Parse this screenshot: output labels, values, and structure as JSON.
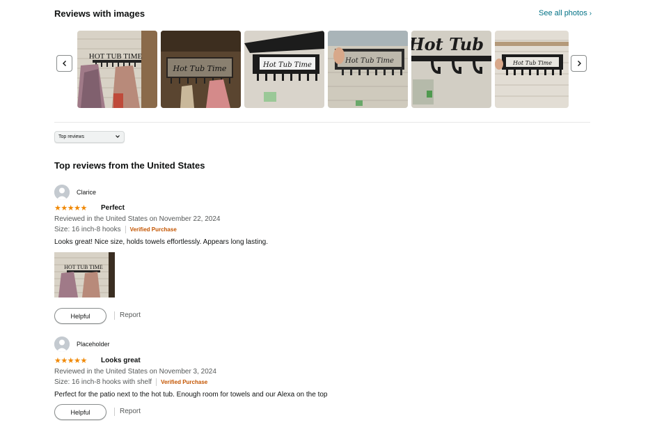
{
  "images_section": {
    "title": "Reviews with images",
    "see_all": "See all photos",
    "see_all_chevron": "›",
    "prev_icon": "chevron-left-icon",
    "next_icon": "chevron-right-icon",
    "thumbnails": [
      {
        "sign_text": "HOT TUB TIME"
      },
      {
        "sign_text": "Hot Tub Time"
      },
      {
        "sign_text": "Hot Tub Time"
      },
      {
        "sign_text": "Hot Tub Time"
      },
      {
        "sign_text": "Hot Tub"
      },
      {
        "sign_text": "Hot Tub Time"
      }
    ]
  },
  "sort": {
    "selected": "Top reviews",
    "caret_icon": "chevron-down-icon"
  },
  "reviews_heading": "Top reviews from the United States",
  "reviews": [
    {
      "name": "Clarice",
      "stars": "★★★★★",
      "rating": 5,
      "title": "Perfect",
      "date_line": "Reviewed in the United States on November 22, 2024",
      "size": "Size: 16 inch-8 hooks",
      "verified": "Verified Purchase",
      "body": "Looks great! Nice size, holds towels effortlessly. Appears long lasting.",
      "image_sign_text": "HOT TUB TIME",
      "helpful": "Helpful",
      "report": "Report"
    },
    {
      "name": "Placeholder",
      "stars": "★★★★★",
      "rating": 5,
      "title": "Looks great",
      "date_line": "Reviewed in the United States on November 3, 2024",
      "size": "Size: 16 inch-8 hooks with shelf",
      "verified": "Verified Purchase",
      "body": "Perfect for the patio next to the hot tub. Enough room for towels and our Alexa on the top",
      "helpful": "Helpful",
      "report": "Report"
    }
  ],
  "colors": {
    "link": "#007185",
    "star": "#f08804",
    "verified": "#c45500",
    "text": "#0f1111",
    "muted": "#565959"
  }
}
